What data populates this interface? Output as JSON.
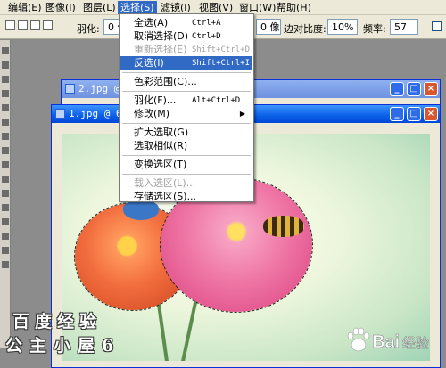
{
  "menubar": {
    "items": [
      {
        "label": "编辑(E)"
      },
      {
        "label": "图像(I)"
      },
      {
        "label": "图层(L)"
      },
      {
        "label": "选择(S)"
      },
      {
        "label": "滤镜(I)"
      },
      {
        "label": "视图(V)"
      },
      {
        "label": "窗口(W)"
      },
      {
        "label": "帮助(H)"
      }
    ]
  },
  "options": {
    "feather_label": "羽化:",
    "feather_value": "0 像",
    "width_value": "0 像",
    "edge_contrast_label": "边对比度:",
    "edge_contrast_value": "10%",
    "frequency_label": "频率:",
    "frequency_value": "57"
  },
  "windows": {
    "back_title": "2.jpg @",
    "front_title": "1.jpg @ 6"
  },
  "dropdown": {
    "items": [
      {
        "label": "全选(A)",
        "shortcut": "Ctrl+A"
      },
      {
        "label": "取消选择(D)",
        "shortcut": "Ctrl+D"
      },
      {
        "label": "重新选择(E)",
        "shortcut": "Shift+Ctrl+D"
      },
      {
        "label": "反选(I)",
        "shortcut": "Shift+Ctrl+I"
      },
      {
        "label": "色彩范围(C)..."
      },
      {
        "label": "羽化(F)...",
        "shortcut": "Alt+Ctrl+D"
      },
      {
        "label": "修改(M)"
      },
      {
        "label": "扩大选取(G)"
      },
      {
        "label": "选取相似(R)"
      },
      {
        "label": "变换选区(T)"
      },
      {
        "label": "载入选区(L)..."
      },
      {
        "label": "存储选区(S)..."
      }
    ]
  },
  "watermark": {
    "line1": "百度经验",
    "line2": "公主小屋6",
    "logo_text": "Bai",
    "logo_suffix": "经验"
  }
}
